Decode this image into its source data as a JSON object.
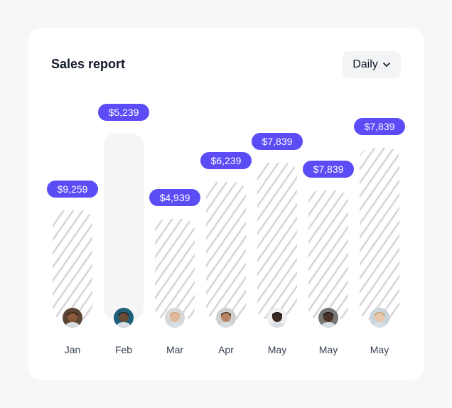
{
  "header": {
    "title": "Sales report",
    "period_label": "Daily"
  },
  "colors": {
    "accent": "#5b4cf5",
    "hatch": "#d9d4dc",
    "bar_selected": "#f5f5f5"
  },
  "icons": {
    "dropdown": "chevron-down-icon"
  },
  "chart_data": {
    "type": "bar",
    "title": "Sales report",
    "categories": [
      "Jan",
      "Feb",
      "Mar",
      "Apr",
      "May",
      "May",
      "May"
    ],
    "data_labels": [
      "$9,259",
      "$5,239",
      "$4,939",
      "$6,239",
      "$7,839",
      "$7,839",
      "$7,839"
    ],
    "values": [
      9259,
      5239,
      4939,
      6239,
      7839,
      7839,
      7839
    ],
    "highlighted_index": 1,
    "ylim": [
      0,
      10000
    ],
    "grid": false,
    "legend": "none"
  }
}
